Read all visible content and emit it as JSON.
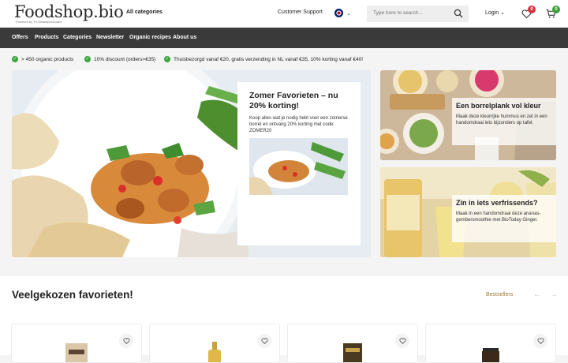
{
  "header": {
    "logo": "Foodshop.bio",
    "logo_tagline": "Powered by Tri-Smaakproducten",
    "all_categories": "All categories",
    "customer_support": "Customer Support",
    "search_placeholder": "Type here to search...",
    "login": "Login",
    "wishlist_count": "0",
    "cart_count": "0"
  },
  "nav": [
    "Offers",
    "Products",
    "Categories",
    "Newsletter",
    "Organic recipes",
    "About us"
  ],
  "usps": [
    "> 450 organic products",
    "10% discount (orders>€35)",
    "Thuisbezorgd vanaf €20, gratis verzending in NL vanaf €35, 10% korting vanaf €40!"
  ],
  "hero": {
    "title": "Zomer Favorieten – nu 20% korting!",
    "text": "Koop alles wat je nodig hebt voor een zomerse borrel en ontvang 20% korting met code: ZOMER20"
  },
  "promo1": {
    "title": "Een borrelplank vol kleur",
    "text": "Maak deze kleurrijke hummus en zet in een handomdraai iets bijzonders op tafel."
  },
  "promo2": {
    "title": "Zin in iets verfrissends?",
    "text": "Maak in een handomdraai deze ananas-gembersmoothie met BioToday Ginger."
  },
  "section": {
    "title": "Veelgekozen favorieten!",
    "link": "Bestsellers"
  },
  "colors": {
    "nav_bg": "#3a3a3a",
    "check_green": "#3aa53a",
    "badge_red": "#d9313c",
    "link_gold": "#a07a3c"
  }
}
